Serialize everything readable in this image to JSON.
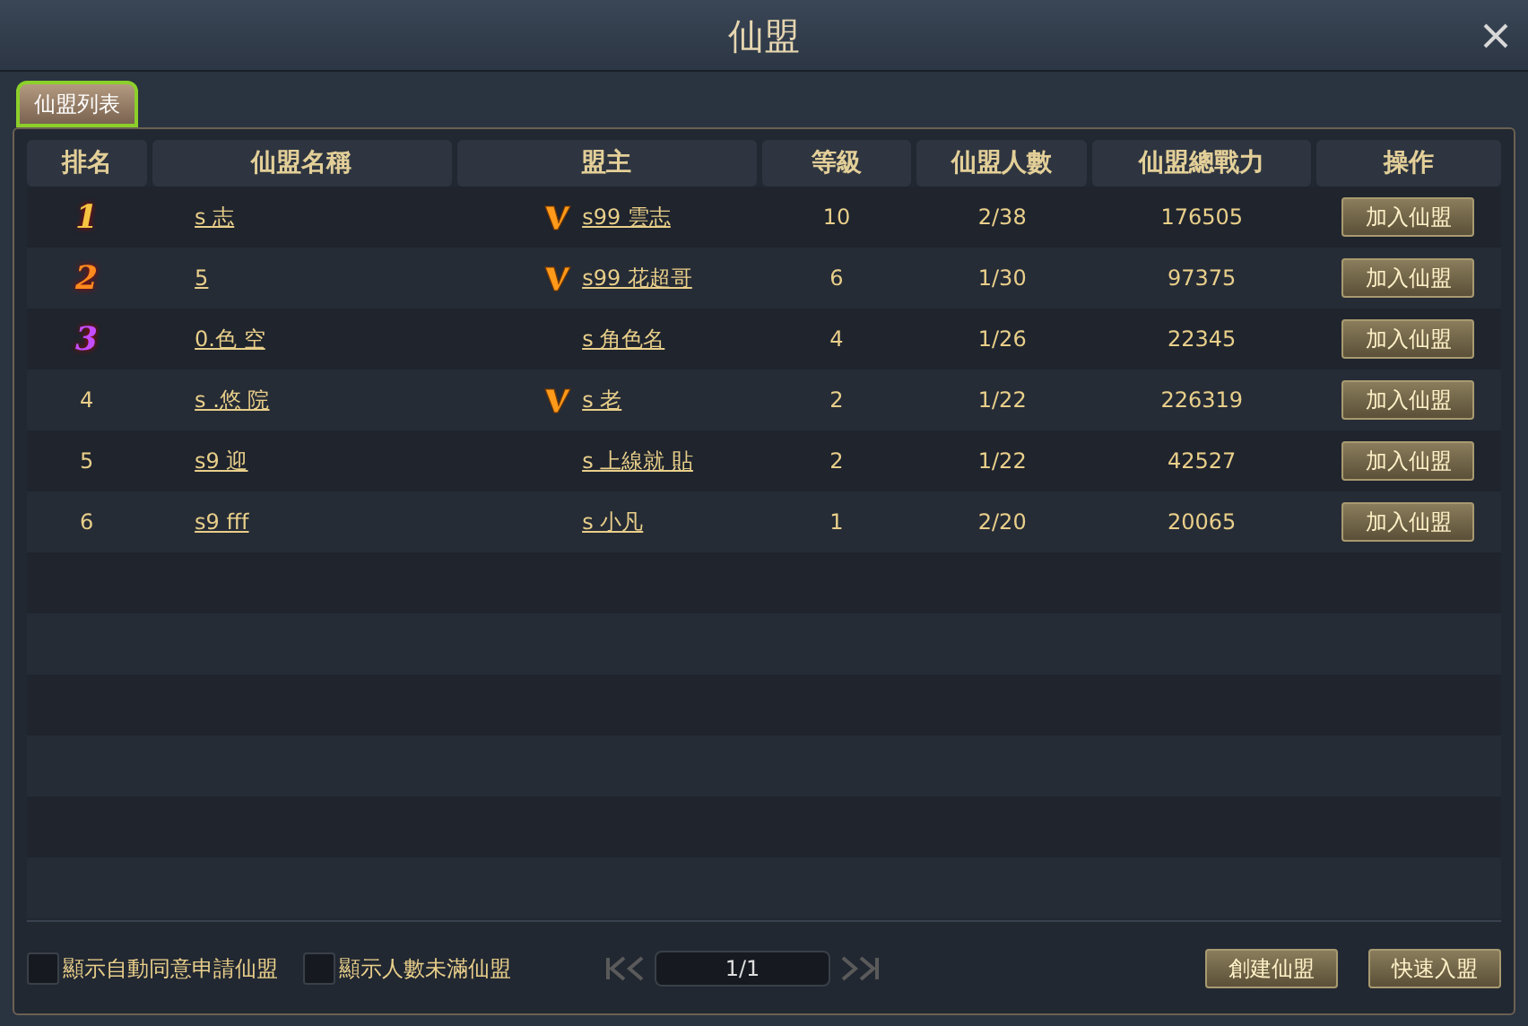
{
  "window": {
    "title": "仙盟"
  },
  "tabs": [
    {
      "label": "仙盟列表",
      "selected": true
    }
  ],
  "table": {
    "columns": [
      "排名",
      "仙盟名稱",
      "盟主",
      "等級",
      "仙盟人數",
      "仙盟總戰力",
      "操作"
    ],
    "rows": [
      {
        "rank": "1",
        "kind": "medal",
        "color": "#f5c542",
        "name": "s 志",
        "leader_vip": true,
        "leader": "s99 雲志",
        "level": "10",
        "members": "2/38",
        "power": "176505",
        "action": "加入仙盟"
      },
      {
        "rank": "2",
        "kind": "medal",
        "color": "#ff8a1e",
        "name": "5",
        "leader_vip": true,
        "leader": "s99 花超哥",
        "level": "6",
        "members": "1/30",
        "power": "97375",
        "action": "加入仙盟"
      },
      {
        "rank": "3",
        "kind": "medal",
        "color": "#c44dff",
        "name": "0.色 空",
        "leader_vip": false,
        "leader": "s 角色名",
        "level": "4",
        "members": "1/26",
        "power": "22345",
        "action": "加入仙盟"
      },
      {
        "rank": "4",
        "kind": "plain",
        "name": "s .悠 院",
        "leader_vip": true,
        "leader": "s 老",
        "level": "2",
        "members": "1/22",
        "power": "226319",
        "action": "加入仙盟"
      },
      {
        "rank": "5",
        "kind": "plain",
        "name": "s9 迎",
        "leader_vip": false,
        "leader": "s 上線就 貼",
        "level": "2",
        "members": "1/22",
        "power": "42527",
        "action": "加入仙盟"
      },
      {
        "rank": "6",
        "kind": "plain",
        "name": "s9 fff",
        "leader_vip": false,
        "leader": "s 小凡",
        "level": "1",
        "members": "2/20",
        "power": "20065",
        "action": "加入仙盟"
      }
    ]
  },
  "filters": [
    {
      "label": "顯示自動同意申請仙盟",
      "checked": false
    },
    {
      "label": "顯示人數未滿仙盟",
      "checked": false
    }
  ],
  "pager": {
    "page": "1/1"
  },
  "buttons": [
    "創建仙盟",
    "快速入盟"
  ]
}
